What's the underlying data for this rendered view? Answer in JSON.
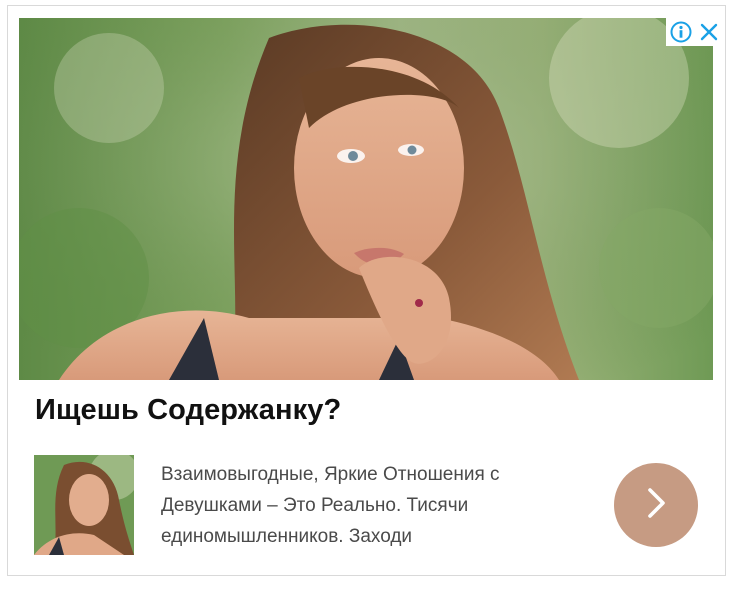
{
  "ad": {
    "headline": "Ищешь Содержанку?",
    "description_lines": [
      "Взаимовыгодные, Яркие Отношения с",
      "Девушками – Это Реально. Тисячи",
      "единомышленников. Заходи"
    ]
  },
  "icons": {
    "info": "info-icon",
    "close": "close-icon",
    "cta": "chevron-right-icon"
  },
  "colors": {
    "adchoices_blue": "#1aa1e6",
    "cta_background": "#c69b83",
    "headline": "#111111",
    "description": "#4a4a4a"
  }
}
